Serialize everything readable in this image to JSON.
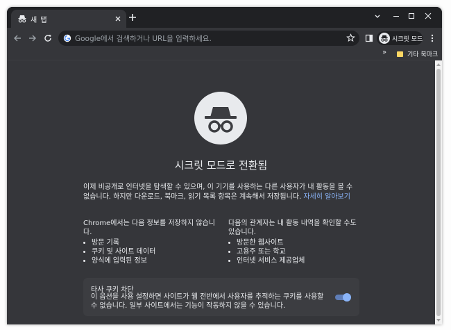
{
  "tab": {
    "title": "새 탭"
  },
  "omnibox": {
    "placeholder": "Google에서 검색하거나 URL을 입력하세요."
  },
  "profile": {
    "label": "시크릿 모드"
  },
  "bookmarks": {
    "overflow": "»",
    "folder_label": "기타 북마크"
  },
  "content": {
    "heading": "시크릿 모드로 전환됨",
    "intro": "이제 비공개로 인터넷을 탐색할 수 있으며, 이 기기를 사용하는 다른 사용자가 내 활동을 볼 수 없습니다. 하지만 다운로드, 북마크, 읽기 목록 항목은 계속해서 저장됩니다.",
    "learn_more": "자세히 알아보기",
    "left_column": {
      "heading": "Chrome에서는 다음 정보를 저장하지 않습니다.",
      "items": [
        "방문 기록",
        "쿠키 및 사이트 데이터",
        "양식에 입력된 정보"
      ]
    },
    "right_column": {
      "heading": "다음의 관계자는 내 활동 내역을 확인할 수도 있습니다.",
      "items": [
        "방문한 웹사이트",
        "고용주 또는 학교",
        "인터넷 서비스 제공업체"
      ]
    },
    "cookie_block": {
      "title": "타사 쿠키 차단",
      "description": "이 옵션을 사용 설정하면 사이트가 웹 전반에서 사용자를 추적하는 쿠키를 사용할 수 없습니다. 일부 사이트에서는 기능이 작동하지 않을 수 있습니다.",
      "enabled": true
    }
  },
  "colors": {
    "frame": "#202124",
    "surface": "#35363a",
    "text": "#e8eaed",
    "link": "#8ab4f8",
    "toggle": "#8ab4f8"
  }
}
